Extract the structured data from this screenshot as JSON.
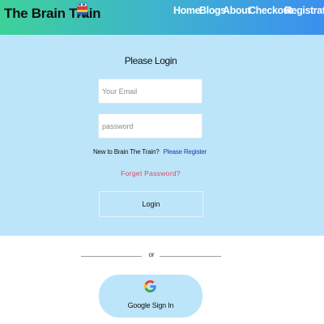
{
  "header": {
    "brand": "The Brain Train",
    "logo_icon": "train-icon",
    "nav": [
      {
        "label": "Home"
      },
      {
        "label": "Blogs"
      },
      {
        "label": "About"
      },
      {
        "label": "Checkout"
      },
      {
        "label": "Registration"
      }
    ],
    "gradient_colors": [
      "#3dd19a",
      "#3fb3cf",
      "#3b8ff0"
    ]
  },
  "login": {
    "title": "Please Login",
    "email_placeholder": "Your Email",
    "password_placeholder": "password",
    "new_user_text": "New to Brain The Train?",
    "register_link": "Please Register",
    "forget_password": "Forget Password?",
    "submit_label": "Login",
    "panel_color": "#bde5fa",
    "forget_color": "#e0475c",
    "register_color": "#1a3aa8"
  },
  "divider": {
    "label": "or"
  },
  "google": {
    "label": "Google Sign In",
    "icon": "google-icon"
  }
}
